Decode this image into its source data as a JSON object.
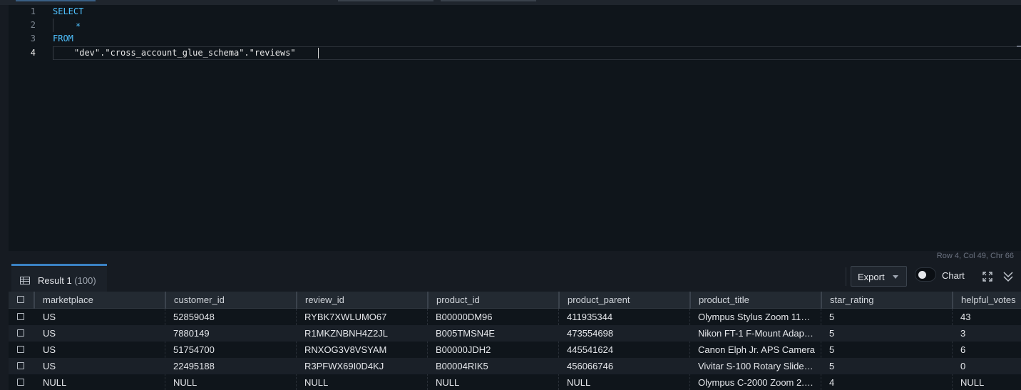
{
  "editor": {
    "lines": [
      {
        "number": "1",
        "text": "SELECT"
      },
      {
        "number": "2",
        "text": "*"
      },
      {
        "number": "3",
        "text": "FROM"
      },
      {
        "number": "4",
        "text": "\"dev\".\"cross_account_glue_schema\".\"reviews\""
      }
    ],
    "status": "Row 4,  Col 49,  Chr 66"
  },
  "results": {
    "tab_label": "Result 1",
    "tab_count": "(100)",
    "export_label": "Export",
    "chart_label": "Chart",
    "chart_toggle_on": false
  },
  "table": {
    "columns": [
      "marketplace",
      "customer_id",
      "review_id",
      "product_id",
      "product_parent",
      "product_title",
      "star_rating",
      "helpful_votes"
    ],
    "rows": [
      [
        "US",
        "52859048",
        "RYBK7XWLUMO67",
        "B00000DM96",
        "411935344",
        "Olympus Stylus Zoom 11…",
        "5",
        "43"
      ],
      [
        "US",
        "7880149",
        "R1MKZNBNH4Z2JL",
        "B005TMSN4E",
        "473554698",
        "Nikon FT-1 F-Mount Adap…",
        "5",
        "3"
      ],
      [
        "US",
        "51754700",
        "RNXOG3V8VSYAM",
        "B00000JDH2",
        "445541624",
        "Canon Elph Jr. APS Camera",
        "5",
        "6"
      ],
      [
        "US",
        "22495188",
        "R3PFWX69I0D4KJ",
        "B00004RIK5",
        "456066746",
        "Vivitar S-100 Rotary Slide…",
        "5",
        "0"
      ],
      [
        "NULL",
        "NULL",
        "NULL",
        "NULL",
        "NULL",
        "Olympus C-2000 Zoom 2.…",
        "4",
        "NULL"
      ]
    ]
  }
}
